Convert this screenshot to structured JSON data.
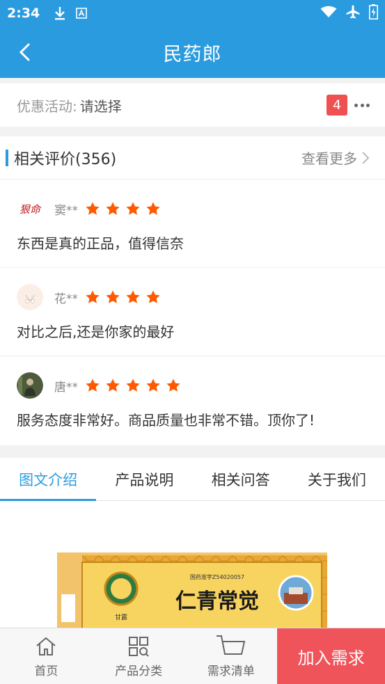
{
  "status_bar": {
    "time": "2:34"
  },
  "header": {
    "title": "民药郎"
  },
  "promo": {
    "label": "优惠活动:",
    "value": "请选择",
    "badge": "4"
  },
  "reviews": {
    "title": "相关评价(356)",
    "see_more": "查看更多",
    "items": [
      {
        "name": "窦**",
        "stars": 4,
        "text": "东西是真的正品，值得信奈",
        "avatar_text": "狠命"
      },
      {
        "name": "花**",
        "stars": 4,
        "text": "对比之后,还是你家的最好"
      },
      {
        "name": "唐**",
        "stars": 5,
        "text": "服务态度非常好。商品质量也非常不错。顶你了!"
      }
    ]
  },
  "tabs": [
    "图文介绍",
    "产品说明",
    "相关问答",
    "关于我们"
  ],
  "product_image": {
    "title": "仁青常觉",
    "approval": "国药准字Z54020057",
    "vendor": "甘露"
  },
  "bottom_nav": {
    "home": "首页",
    "category": "产品分类",
    "list": "需求清单",
    "add": "加入需求"
  },
  "colors": {
    "primary": "#2b9be0",
    "star": "#ff5a00",
    "cta": "#f0545b",
    "badge": "#f05050"
  }
}
